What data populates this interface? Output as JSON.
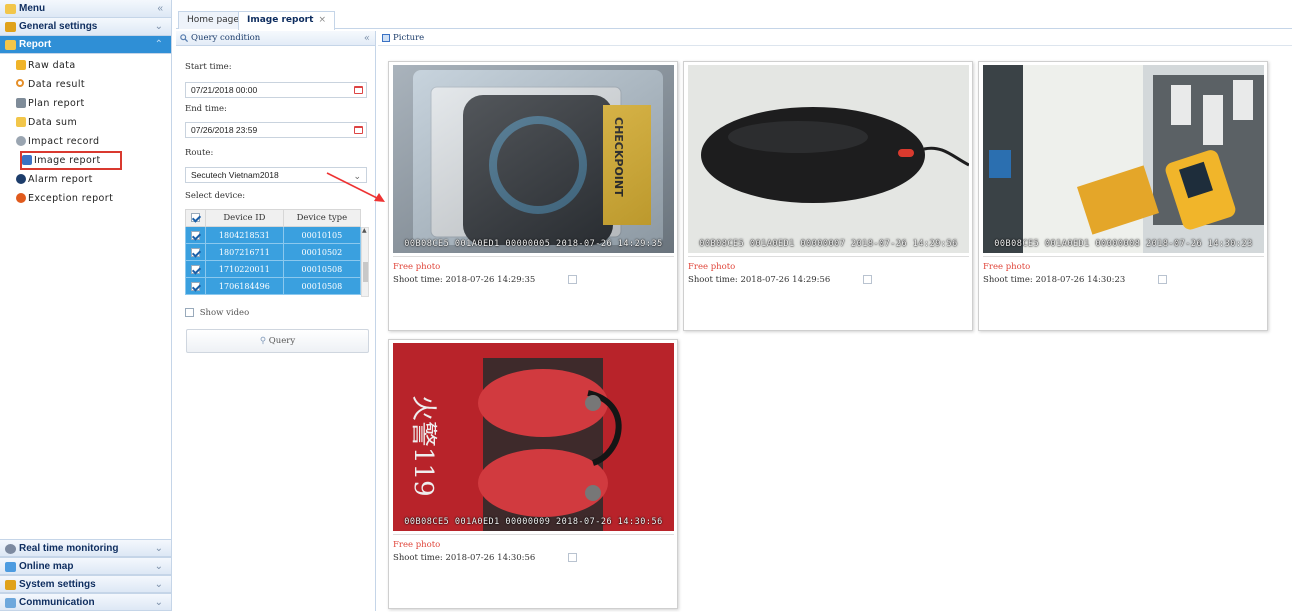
{
  "menu": {
    "title": "Menu",
    "sections_top": [
      {
        "label": "General settings",
        "icon": "settings-folder-icon",
        "color": "#e0a21a"
      },
      {
        "label": "Report",
        "icon": "report-icon",
        "color": "#f2c64a",
        "active": true
      }
    ],
    "report_items": [
      {
        "label": "Raw data",
        "icon": "raw-data-icon",
        "color": "#f0b429"
      },
      {
        "label": "Data result",
        "icon": "magnifier-icon",
        "color": "#e58f2a"
      },
      {
        "label": "Plan report",
        "icon": "plan-report-icon",
        "color": "#7f8c99"
      },
      {
        "label": "Data sum",
        "icon": "data-sum-icon",
        "color": "#f2c64a"
      },
      {
        "label": "Impact record",
        "icon": "impact-record-icon",
        "color": "#9aa5b1"
      },
      {
        "label": "Image report",
        "icon": "image-report-icon",
        "color": "#3a72c4"
      },
      {
        "label": "Alarm report",
        "icon": "alarm-icon",
        "color": "#1d3d6b"
      },
      {
        "label": "Exception report",
        "icon": "exception-icon",
        "color": "#e05a1d"
      }
    ],
    "sections_bottom": [
      {
        "label": "Real time monitoring",
        "icon": "monitor-icon",
        "color": "#7d8aa0"
      },
      {
        "label": "Online map",
        "icon": "map-icon",
        "color": "#4c9be0"
      },
      {
        "label": "System settings",
        "icon": "system-settings-icon",
        "color": "#e0a21a"
      },
      {
        "label": "Communication",
        "icon": "communication-icon",
        "color": "#6ea8dc"
      }
    ]
  },
  "tabs": [
    {
      "label": "Home page"
    },
    {
      "label": "Image report",
      "close": "×",
      "active": true
    }
  ],
  "query": {
    "title": "Query condition",
    "start_label": "Start time:",
    "start_value": "07/21/2018 00:00",
    "end_label": "End time:",
    "end_value": "07/26/2018 23:59",
    "route_label": "Route:",
    "route_value": "Secutech Vietnam2018",
    "device_label": "Select device:",
    "device_columns": [
      "Device ID",
      "Device type"
    ],
    "devices": [
      {
        "id": "1804218531",
        "type": "00010105",
        "checked": true
      },
      {
        "id": "1807216711",
        "type": "00010502",
        "checked": true
      },
      {
        "id": "1710220011",
        "type": "00010508",
        "checked": true
      },
      {
        "id": "1706184496",
        "type": "00010508",
        "checked": true
      }
    ],
    "show_video_label": "Show video",
    "show_video_checked": false,
    "query_button": "Query"
  },
  "picture": {
    "title": "Picture",
    "photos": [
      {
        "type": "Free photo",
        "shoot_label": "Shoot time:",
        "shoot_time": "2018-07-26 14:29:35",
        "stamp": "00B08CE5 001A0ED1 00000005 2018-07-26 14:29:35",
        "subject": "checkpoint-tag-photo"
      },
      {
        "type": "Free photo",
        "shoot_label": "Shoot time:",
        "shoot_time": "2018-07-26 14:29:56",
        "stamp": "00B08CE5 001A0ED1 00000007 2018-07-26 14:29:56",
        "subject": "computer-mouse-photo"
      },
      {
        "type": "Free photo",
        "shoot_label": "Shoot time:",
        "shoot_time": "2018-07-26 14:30:23",
        "stamp": "00B08CE5 001A0ED1 00000008 2018-07-26 14:30:23",
        "subject": "handheld-device-photo"
      },
      {
        "type": "Free photo",
        "shoot_label": "Shoot time:",
        "shoot_time": "2018-07-26 14:30:56",
        "stamp": "00B08CE5 001A0ED1 00000009 2018-07-26 14:30:56",
        "subject": "fire-extinguisher-photo"
      }
    ]
  },
  "colors": {
    "accent": "#2f8fd6",
    "selected_row": "#3aa0df",
    "highlight_border": "#d9392f",
    "photo_type": "#e0463b"
  }
}
